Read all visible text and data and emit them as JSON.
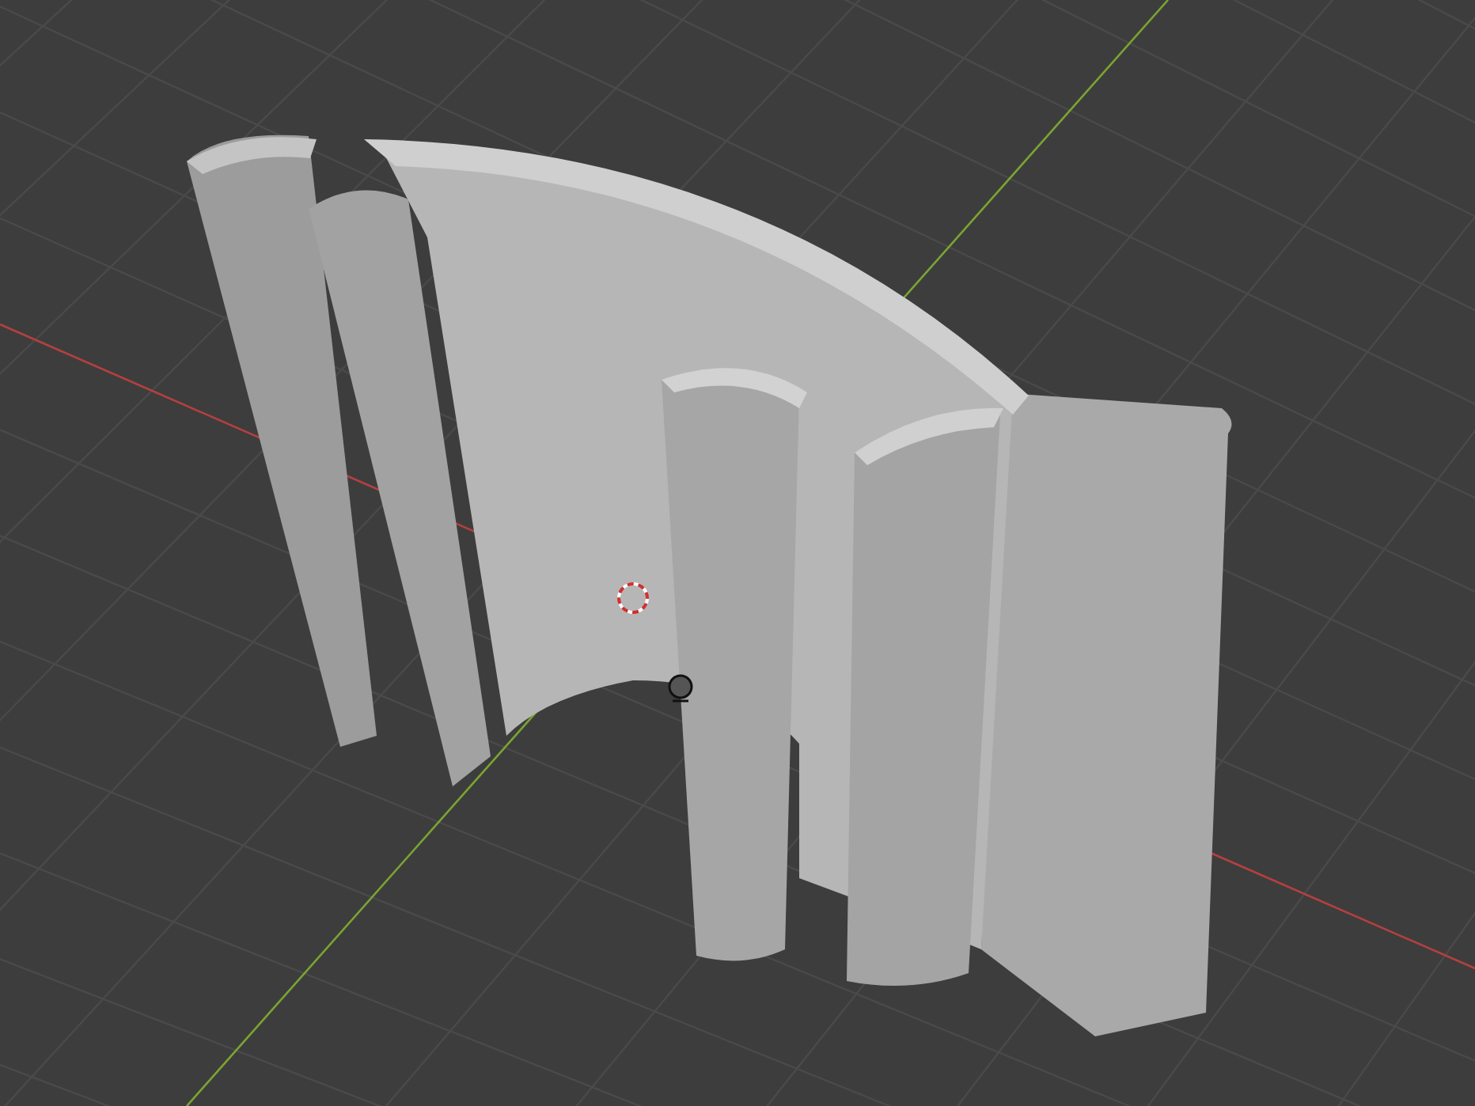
{
  "viewport": {
    "grid": true,
    "x_axis": true,
    "y_axis": true,
    "object": {
      "kind": "extrusion"
    },
    "cursor": true,
    "light": true
  }
}
